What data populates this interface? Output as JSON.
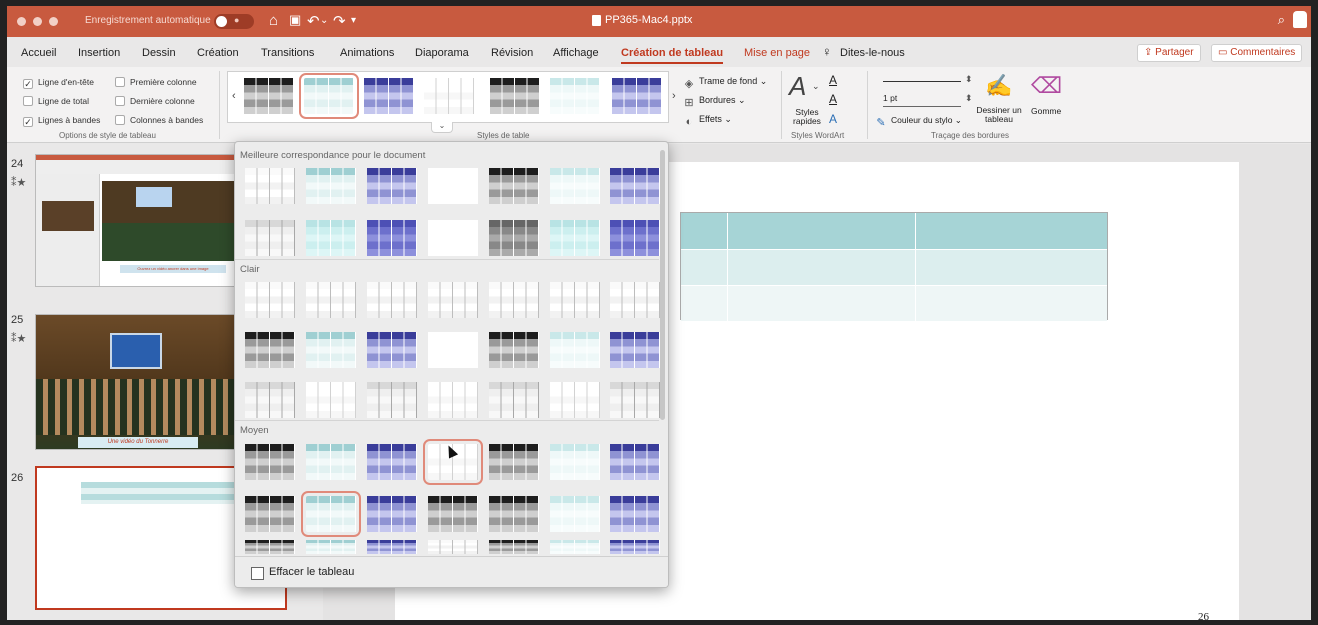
{
  "window": {
    "autosave_label": "Enregistrement automatique",
    "autosave_state": "●",
    "doc_title": "PP365-Mac4.pptx",
    "home_icon": "house-icon",
    "save_icon": "save-icon",
    "undo_icon": "undo-icon",
    "redo_icon": "redo-icon"
  },
  "tabs": [
    {
      "label": "Accueil"
    },
    {
      "label": "Insertion"
    },
    {
      "label": "Dessin"
    },
    {
      "label": "Création"
    },
    {
      "label": "Transitions"
    },
    {
      "label": "Animations"
    },
    {
      "label": "Diaporama"
    },
    {
      "label": "Révision"
    },
    {
      "label": "Affichage"
    },
    {
      "label": "Création de tableau"
    },
    {
      "label": "Mise en page"
    },
    {
      "label": "Dites-le-nous"
    }
  ],
  "share_label": "Partager",
  "comments_label": "Commentaires",
  "ribbon": {
    "options": {
      "header_row": "Ligne d'en-tête",
      "total_row": "Ligne de total",
      "banded_rows": "Lignes à bandes",
      "first_column": "Première colonne",
      "last_column": "Dernière colonne",
      "banded_columns": "Colonnes à bandes",
      "group_label": "Options de style de tableau"
    },
    "styles_group_label": "Styles de table",
    "shading": "Trame de fond",
    "borders": "Bordures",
    "effects": "Effets",
    "quick_styles": "Styles rapides",
    "wordart_group_label": "Styles WordArt",
    "pen_weight": "1 pt",
    "pen_color": "Couleur du stylo",
    "draw_table": "Dessiner un tableau",
    "eraser": "Gomme",
    "draw_group_label": "Traçage des bordures"
  },
  "slides": [
    {
      "number": "24",
      "caption": "Ouvrez un vidéo ancrer dans une image"
    },
    {
      "number": "25",
      "caption": "Une vidéo du Tonnerre"
    },
    {
      "number": "26"
    }
  ],
  "dropdown": {
    "section_best": "Meilleure correspondance pour le document",
    "section_light": "Clair",
    "section_medium": "Moyen",
    "clear_table": "Effacer le tableau"
  },
  "slide_number": "26",
  "colors": {
    "accent": "#c0391f",
    "titlebar": "#c85a3f",
    "teal": "#a8d6d8",
    "navy": "#3a3d9a"
  }
}
